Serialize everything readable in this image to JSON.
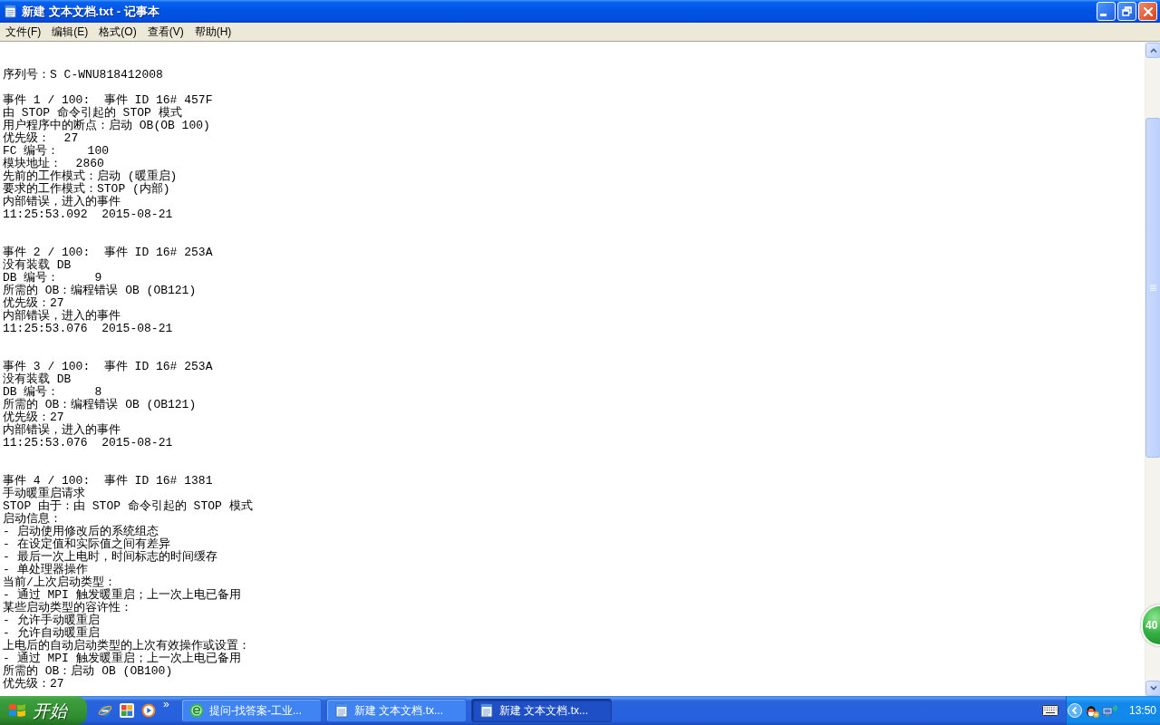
{
  "window": {
    "title": "新建 文本文档.txt - 记事本"
  },
  "menu": [
    "文件(F)",
    "编辑(E)",
    "格式(O)",
    "查看(V)",
    "帮助(H)"
  ],
  "document": {
    "serial_line": "序列号：S C-WNU818412008",
    "events": [
      {
        "lines": [
          "事件 1 / 100:  事件 ID 16# 457F",
          "由 STOP 命令引起的 STOP 模式",
          "用户程序中的断点：启动 OB(OB 100)",
          "优先级：  27",
          "FC 编号：    100",
          "模块地址：  2860",
          "先前的工作模式：启动 (暖重启)",
          "要求的工作模式：STOP (内部)",
          "内部错误，进入的事件",
          "11:25:53.092  2015-08-21"
        ]
      },
      {
        "lines": [
          "事件 2 / 100:  事件 ID 16# 253A",
          "没有装载 DB",
          "DB 编号：     9",
          "所需的 OB：编程错误 OB (OB121)",
          "优先级：27",
          "内部错误，进入的事件",
          "11:25:53.076  2015-08-21"
        ]
      },
      {
        "lines": [
          "事件 3 / 100:  事件 ID 16# 253A",
          "没有装载 DB",
          "DB 编号：     8",
          "所需的 OB：编程错误 OB (OB121)",
          "优先级：27",
          "内部错误，进入的事件",
          "11:25:53.076  2015-08-21"
        ]
      },
      {
        "lines": [
          "事件 4 / 100:  事件 ID 16# 1381",
          "手动暖重启请求",
          "STOP 由于：由 STOP 命令引起的 STOP 模式",
          "启动信息：",
          "- 启动使用修改后的系统组态",
          "- 在设定值和实际值之间有差异",
          "- 最后一次上电时，时间标志的时间缓存",
          "- 单处理器操作",
          "当前/上次启动类型：",
          "- 通过 MPI 触发暖重启；上一次上电已备用",
          "某些启动类型的容许性：",
          "- 允许手动暖重启",
          "- 允许自动暖重启",
          "上电后的自动启动类型的上次有效操作或设置：",
          "- 通过 MPI 触发暖重启；上一次上电已备用",
          "所需的 OB：启动 OB (OB100)",
          "优先级：27"
        ]
      }
    ]
  },
  "floating_badge": {
    "text": "40"
  },
  "taskbar": {
    "start_label": "开始",
    "quick_launch_overflow": "»",
    "tasks": [
      {
        "label": "提问-找答案-工业...",
        "kind": "browser",
        "selected": false
      },
      {
        "label": "新建 文本文档.tx...",
        "kind": "notepad",
        "selected": false
      },
      {
        "label": "新建 文本文档.tx...",
        "kind": "notepad",
        "selected": true
      }
    ],
    "clock": "13:50"
  }
}
